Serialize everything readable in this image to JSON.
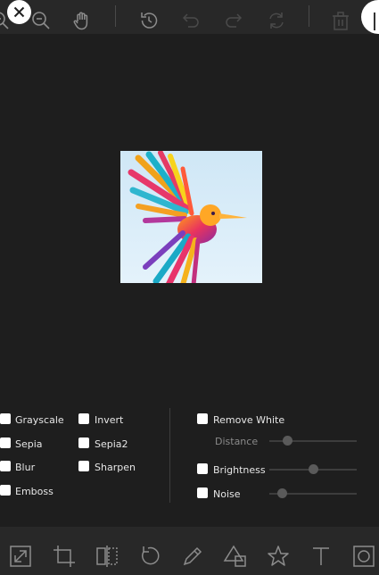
{
  "toolbar": {
    "icons": [
      "zoom-in-icon",
      "zoom-out-icon",
      "hand-icon",
      "history-icon",
      "undo-icon",
      "redo-icon",
      "reset-icon",
      "delete-icon"
    ]
  },
  "filters": {
    "grayscale": "Grayscale",
    "invert": "Invert",
    "sepia": "Sepia",
    "sepia2": "Sepia2",
    "blur": "Blur",
    "sharpen": "Sharpen",
    "emboss": "Emboss",
    "remove_white": "Remove White",
    "distance": "Distance",
    "brightness": "Brightness",
    "noise": "Noise"
  },
  "sliders": {
    "distance": 0.21,
    "brightness": 0.5,
    "noise": 0.15
  },
  "bottom_menu": {
    "icons": [
      "resize-icon",
      "crop-icon",
      "flip-icon",
      "rotate-icon",
      "draw-icon",
      "shape-icon",
      "icon-icon",
      "text-icon",
      "mask-icon"
    ]
  },
  "colors": {
    "background": "#1e1e1e",
    "toolbar": "#282828",
    "icon": "#8c8c8c"
  }
}
